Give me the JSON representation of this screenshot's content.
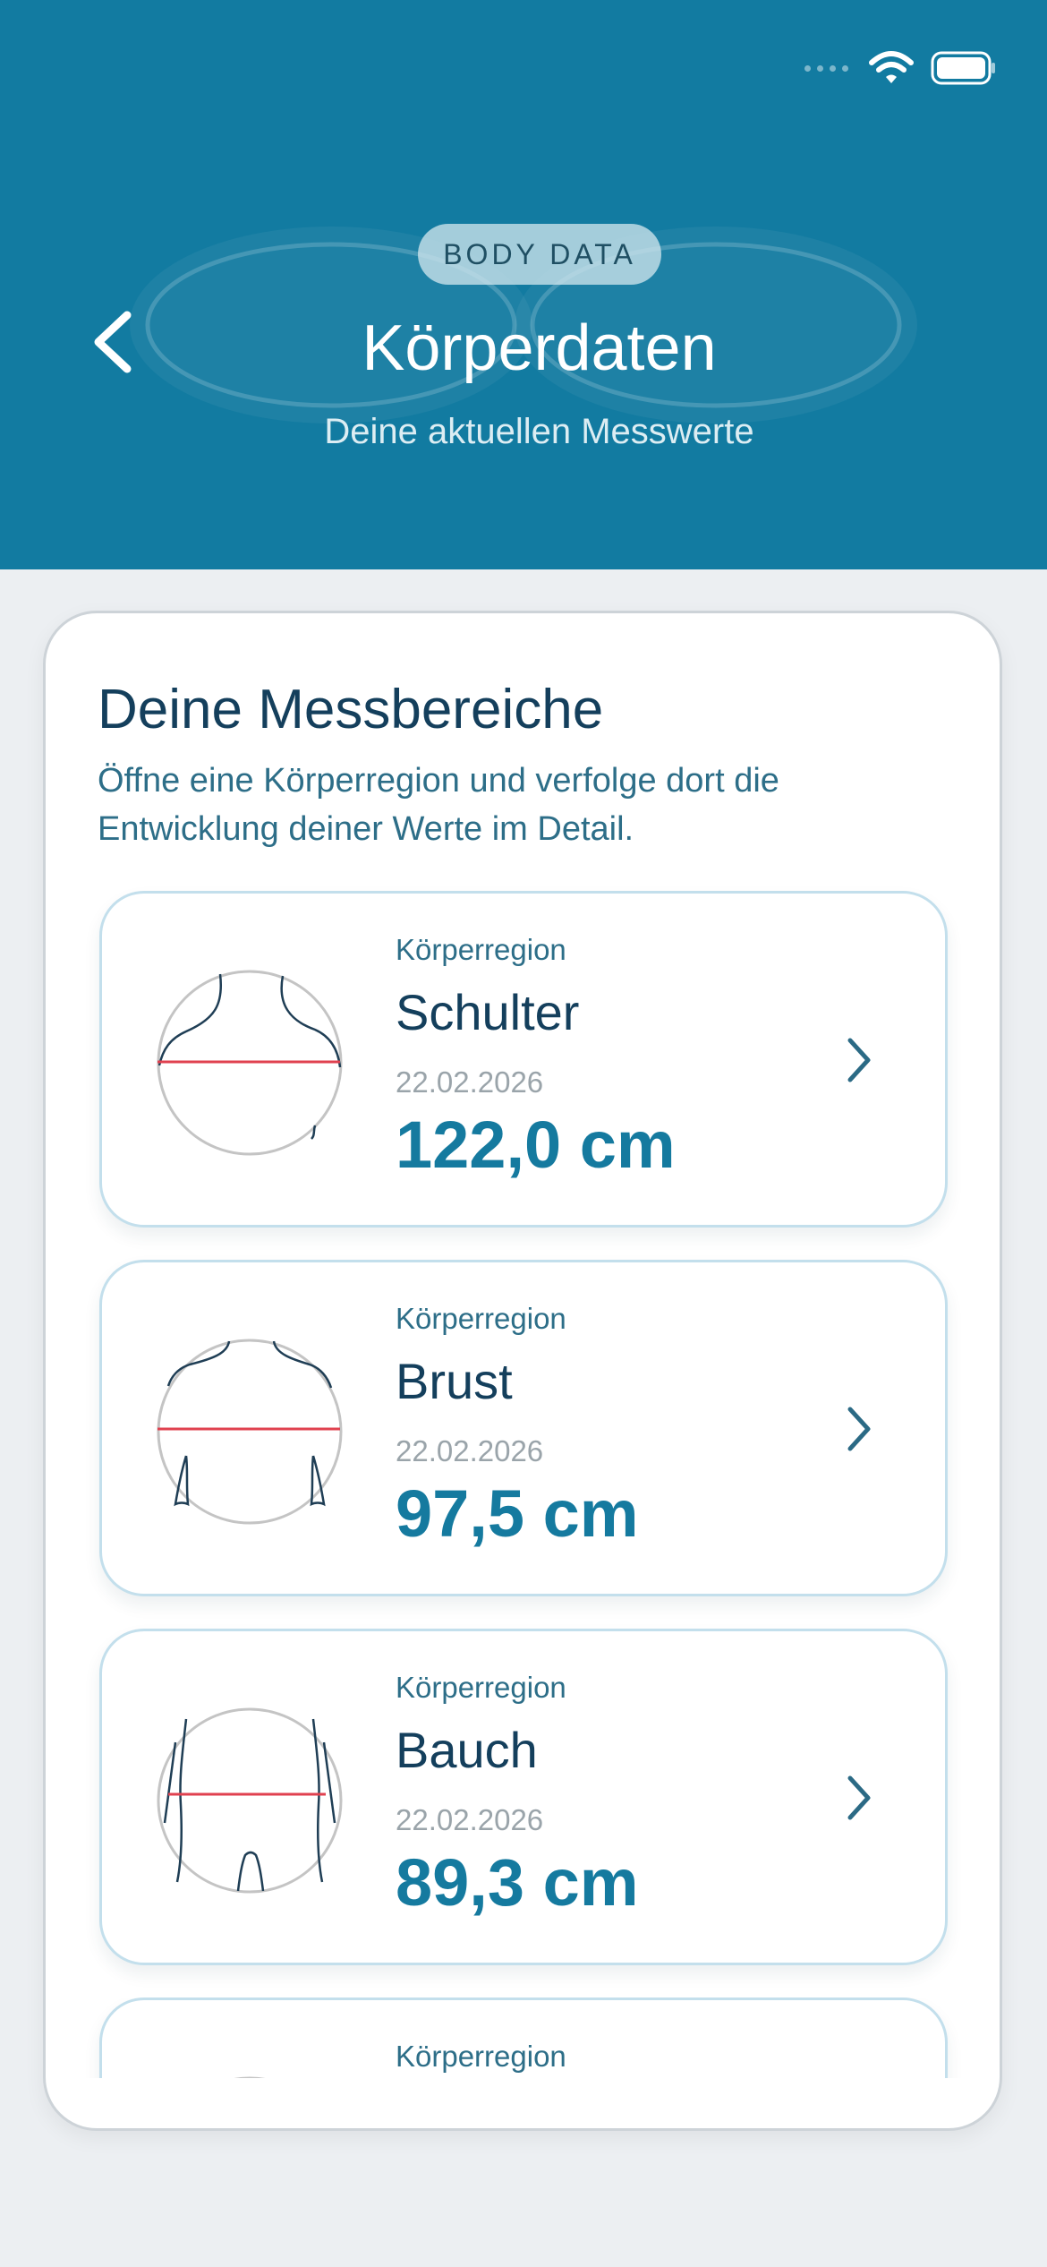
{
  "header": {
    "badge": "BODY DATA",
    "title": "Körperdaten",
    "subtitle": "Deine aktuellen Messwerte",
    "back_icon": "chevron-left-icon",
    "background_color": "#127ba1"
  },
  "status_bar": {
    "icons": [
      "signal-icon",
      "wifi-icon",
      "battery-icon"
    ]
  },
  "section": {
    "title": "Deine Messbereiche",
    "description": "Öffne eine Körperregion und verfolge dort die Entwicklung deiner Werte im Detail."
  },
  "regions": [
    {
      "label": "Körperregion",
      "name": "Schulter",
      "date": "22.02.2026",
      "value": "122,0 cm",
      "icon": "shoulder-illustration"
    },
    {
      "label": "Körperregion",
      "name": "Brust",
      "date": "22.02.2026",
      "value": "97,5 cm",
      "icon": "chest-illustration"
    },
    {
      "label": "Körperregion",
      "name": "Bauch",
      "date": "22.02.2026",
      "value": "89,3 cm",
      "icon": "belly-illustration"
    },
    {
      "label": "Körperregion",
      "icon": "body-illustration"
    }
  ],
  "colors": {
    "accent": "#157a9f",
    "measure_line": "#e0414f"
  }
}
